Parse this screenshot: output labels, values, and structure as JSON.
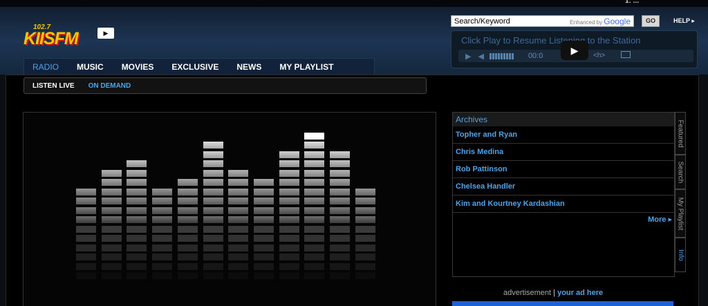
{
  "brand": {
    "logo_frequency": "102.7",
    "logo_name": "KIISFM",
    "top_right_text": "1: ..."
  },
  "nav": {
    "items": [
      {
        "label": "RADIO",
        "active": true
      },
      {
        "label": "MUSIC",
        "active": false
      },
      {
        "label": "MOVIES",
        "active": false
      },
      {
        "label": "EXCLUSIVE",
        "active": false
      },
      {
        "label": "NEWS",
        "active": false
      },
      {
        "label": "MY PLAYLIST",
        "active": false
      }
    ]
  },
  "subnav": {
    "items": [
      {
        "label": "LISTEN LIVE",
        "active": false
      },
      {
        "label": "ON DEMAND",
        "active": true
      }
    ]
  },
  "search": {
    "value": "Search/Keyword",
    "enhanced_label": "Enhanced by",
    "enhanced_brand": "Google",
    "go_label": "GO"
  },
  "help_label": "HELP ▸",
  "player": {
    "message": "Click Play to Resume Listening to the Station",
    "time": "00:0",
    "tag": "<h>",
    "icons": {
      "play": "play-icon",
      "volume": "speaker-icon",
      "video_play": "play-icon",
      "mail": "envelope-icon"
    }
  },
  "visualizer": {
    "levels": [
      0.42,
      0.62,
      0.72,
      0.42,
      0.52,
      0.85,
      0.62,
      0.52,
      0.75,
      0.95,
      0.75,
      0.42
    ]
  },
  "archives": {
    "title": "Archives",
    "items": [
      "Topher and Ryan",
      "Chris Medina",
      "Rob Pattinson",
      "Chelsea Handler",
      "Kim and Kourtney Kardashian"
    ],
    "more_label": "More ▸"
  },
  "side_tabs": [
    {
      "label": "Featured",
      "active": false
    },
    {
      "label": "Search",
      "active": false
    },
    {
      "label": "My Playlist",
      "active": false
    },
    {
      "label": "Info",
      "active": true
    }
  ],
  "ad": {
    "label": "advertisement",
    "separator": "|",
    "link": "your ad here"
  },
  "colors": {
    "accent": "#4fa3e8",
    "logo_yellow": "#f5c400",
    "logo_red": "#c4151c"
  }
}
